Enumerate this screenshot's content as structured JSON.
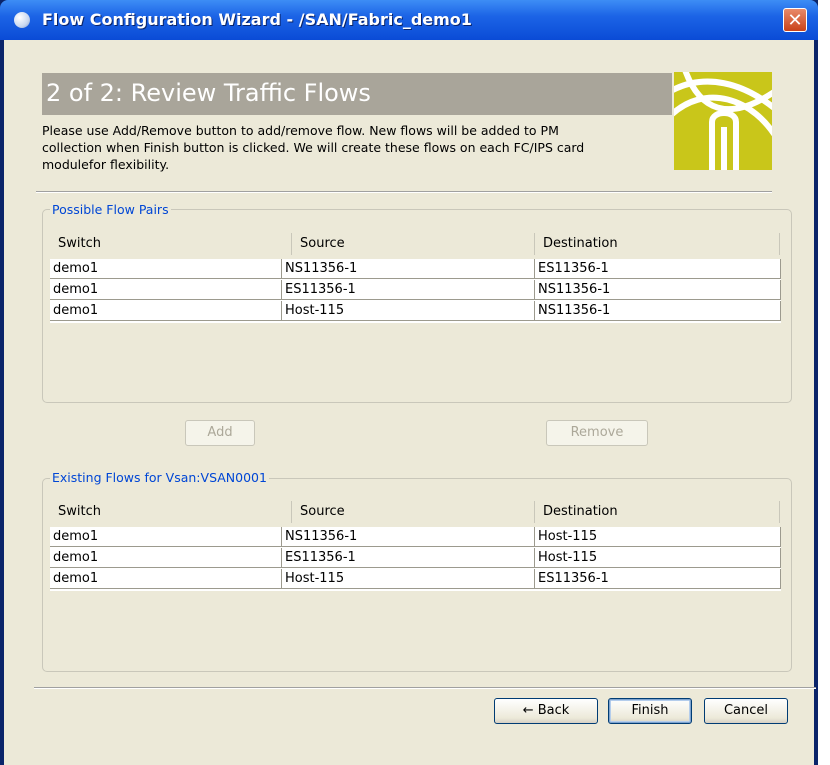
{
  "window": {
    "title": "Flow Configuration Wizard - /SAN/Fabric_demo1"
  },
  "header": {
    "title": "2 of 2: Review Traffic Flows",
    "description_lines": [
      "Please use Add/Remove button to add/remove flow. New flows will be added to PM",
      "collection when Finish button is clicked. We will create these flows on each FC/IPS card",
      "modulefor flexibility."
    ]
  },
  "possible_flows": {
    "label": "Possible Flow Pairs",
    "columns": [
      "Switch",
      "Source",
      "Destination"
    ],
    "rows": [
      [
        "demo1",
        "NS11356-1",
        "ES11356-1"
      ],
      [
        "demo1",
        "ES11356-1",
        "NS11356-1"
      ],
      [
        "demo1",
        "Host-115",
        "NS11356-1"
      ]
    ]
  },
  "actions": {
    "add_label": "Add",
    "remove_label": "Remove"
  },
  "existing_flows": {
    "label": "Existing Flows for Vsan:VSAN0001",
    "columns": [
      "Switch",
      "Source",
      "Destination"
    ],
    "rows": [
      [
        "demo1",
        "NS11356-1",
        "Host-115"
      ],
      [
        "demo1",
        "ES11356-1",
        "Host-115"
      ],
      [
        "demo1",
        "Host-115",
        "ES11356-1"
      ]
    ]
  },
  "footer": {
    "back_label": "Back",
    "finish_label": "Finish",
    "cancel_label": "Cancel"
  },
  "icons": {
    "close": "close-icon",
    "app": "app-icon",
    "back": "back-arrow-icon"
  },
  "colors": {
    "titlebar": "#1c64e6",
    "header_bar": "#a9a59a",
    "logo": "#c9c61a",
    "group_label": "#0046d5"
  }
}
